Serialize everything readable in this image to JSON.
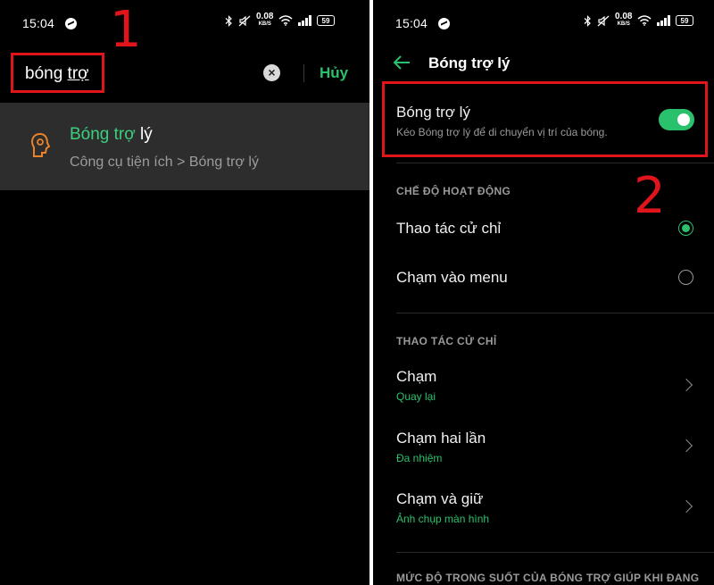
{
  "left": {
    "status": {
      "time": "15:04",
      "speed_value": "0.08",
      "speed_unit": "KB/S",
      "battery": "59"
    },
    "search": {
      "query_plain": "bóng ",
      "query_underlined": "trợ",
      "cancel_label": "Hủy"
    },
    "step_label": "1",
    "result": {
      "title_highlight": "Bóng trợ",
      "title_rest": " lý",
      "path": "Công cụ tiện ích > Bóng trợ lý",
      "icon": "bulb-head-icon"
    }
  },
  "right": {
    "status": {
      "time": "15:04",
      "speed_value": "0.08",
      "speed_unit": "KB/S",
      "battery": "59"
    },
    "header": {
      "title": "Bóng trợ lý"
    },
    "main_toggle": {
      "title": "Bóng trợ lý",
      "description": "Kéo Bóng trợ lý để di chuyển vị trí của bóng.",
      "enabled": true
    },
    "step_label": "2",
    "mode_section": {
      "header": "CHẾ ĐỘ HOẠT ĐỘNG",
      "options": [
        {
          "label": "Thao tác cử chỉ",
          "selected": true
        },
        {
          "label": "Chạm vào menu",
          "selected": false
        }
      ]
    },
    "gesture_section": {
      "header": "THAO TÁC CỬ CHỈ",
      "items": [
        {
          "title": "Chạm",
          "value": "Quay lại"
        },
        {
          "title": "Chạm hai lần",
          "value": "Đa nhiệm"
        },
        {
          "title": "Chạm và giữ",
          "value": "Ảnh chụp màn hình"
        }
      ]
    },
    "transparency_section": {
      "header": "MỨC ĐỘ TRONG SUỐT CỦA BÓNG TRỢ GIÚP KHI ĐANG"
    }
  },
  "colors": {
    "accent": "#2ac16c",
    "annotation_red": "#e0141b",
    "background": "#000000",
    "result_row": "#2d2d2d"
  }
}
